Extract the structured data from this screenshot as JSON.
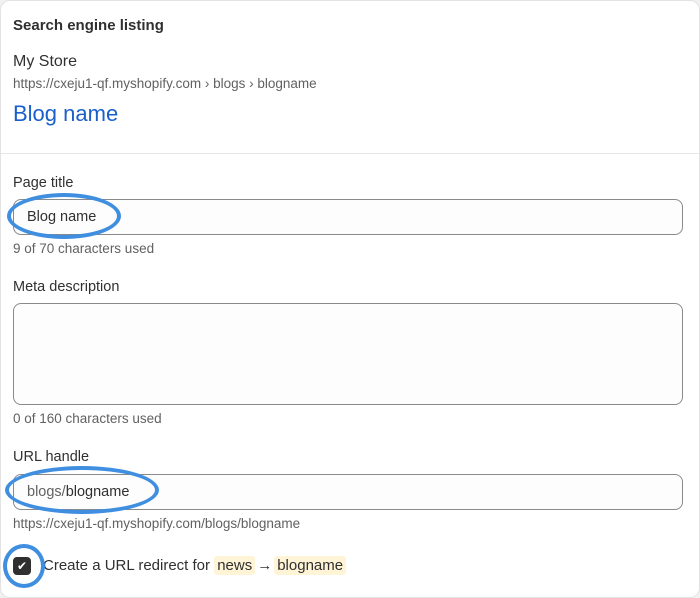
{
  "seo": {
    "section_title": "Search engine listing",
    "store_name": "My Store",
    "url_preview": "https://cxeju1-qf.myshopify.com › blogs › blogname",
    "preview_title": "Blog name"
  },
  "page_title": {
    "label": "Page title",
    "value": "Blog name",
    "help": "9 of 70 characters used"
  },
  "meta_description": {
    "label": "Meta description",
    "value": "",
    "help": "0 of 160 characters used"
  },
  "url_handle": {
    "label": "URL handle",
    "prefix": "blogs/",
    "value": "blogname",
    "help": "https://cxeju1-qf.myshopify.com/blogs/blogname"
  },
  "redirect": {
    "checked": true,
    "check_icon": "checkmark-icon",
    "label": "Create a URL redirect for",
    "from": "news",
    "arrow": "→",
    "to": "blogname"
  },
  "colors": {
    "link": "#1a5fcc",
    "highlight_ring": "#3f8ee0",
    "chip_bg": "#fff4d6"
  }
}
